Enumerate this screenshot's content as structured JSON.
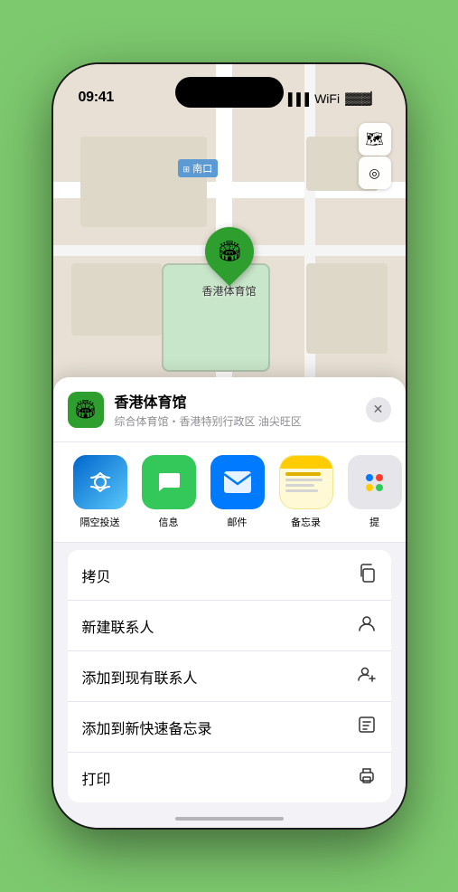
{
  "status_bar": {
    "time": "09:41",
    "location_arrow": "▶"
  },
  "map": {
    "label_text": "南口",
    "label_prefix": "圆",
    "layers_icon": "🗺",
    "location_icon": "⊕",
    "pin_emoji": "🏟",
    "pin_label": "香港体育馆"
  },
  "location_card": {
    "icon_emoji": "🏟",
    "name": "香港体育馆",
    "address": "综合体育馆・香港特别行政区 油尖旺区",
    "close_icon": "✕"
  },
  "share_apps": [
    {
      "id": "airdrop",
      "label": "隔空投送",
      "emoji": "📡"
    },
    {
      "id": "messages",
      "label": "信息",
      "emoji": "💬"
    },
    {
      "id": "mail",
      "label": "邮件",
      "emoji": "✉️"
    },
    {
      "id": "notes",
      "label": "备忘录",
      "highlighted": true
    },
    {
      "id": "more",
      "label": "提",
      "emoji": "⋯"
    }
  ],
  "actions": [
    {
      "id": "copy",
      "label": "拷贝",
      "icon": "⎘"
    },
    {
      "id": "new-contact",
      "label": "新建联系人",
      "icon": "👤"
    },
    {
      "id": "add-contact",
      "label": "添加到现有联系人",
      "icon": "👤+"
    },
    {
      "id": "quick-note",
      "label": "添加到新快速备忘录",
      "icon": "📋"
    },
    {
      "id": "print",
      "label": "打印",
      "icon": "🖨"
    }
  ],
  "notes_app": {
    "top_color": "#ffcc00",
    "bg_color": "#fffde7"
  }
}
